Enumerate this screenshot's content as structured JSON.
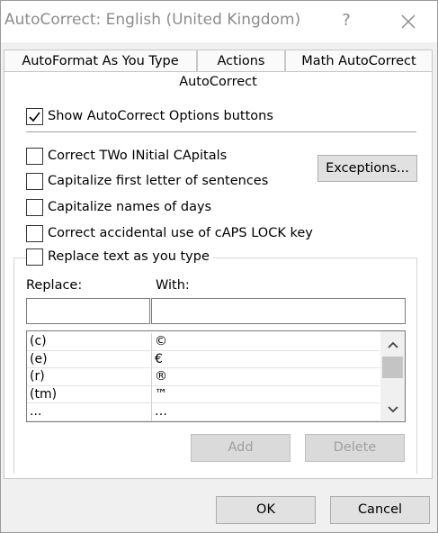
{
  "window": {
    "title": "AutoCorrect: English (United Kingdom)",
    "help_glyph": "?",
    "close_icon": "close-icon"
  },
  "tabs": {
    "row1": [
      "AutoFormat As You Type",
      "Actions",
      "Math AutoCorrect"
    ],
    "active": "AutoCorrect"
  },
  "options": {
    "show_buttons": {
      "label": "Show AutoCorrect Options buttons",
      "checked": true
    },
    "two_initial_caps": {
      "label": "Correct TWo INitial CApitals",
      "checked": false
    },
    "capitalize_sentences": {
      "label": "Capitalize first letter of sentences",
      "checked": false
    },
    "capitalize_days": {
      "label": "Capitalize names of days",
      "checked": false
    },
    "caps_lock": {
      "label": "Correct accidental use of cAPS LOCK key",
      "checked": false
    },
    "replace_text": {
      "label": "Replace text as you type",
      "checked": false
    }
  },
  "exceptions_label": "Exceptions...",
  "replace": {
    "replace_label": "Replace:",
    "with_label": "With:",
    "replace_value": "",
    "with_value": "",
    "entries": [
      {
        "replace": "(c)",
        "with": "©"
      },
      {
        "replace": "(e)",
        "with": "€"
      },
      {
        "replace": "(r)",
        "with": "®"
      },
      {
        "replace": "(tm)",
        "with": "™"
      },
      {
        "replace": "...",
        "with": "…"
      }
    ],
    "add_label": "Add",
    "delete_label": "Delete"
  },
  "footer": {
    "ok_label": "OK",
    "cancel_label": "Cancel"
  }
}
